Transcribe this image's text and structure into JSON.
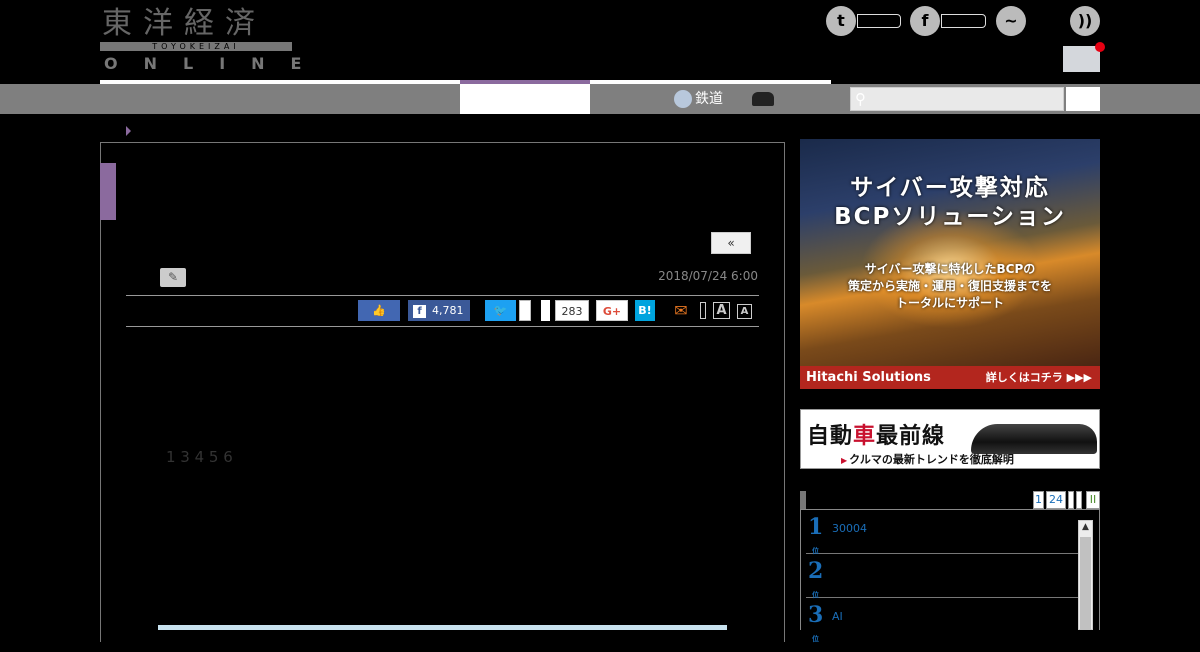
{
  "header": {
    "logo": {
      "kanji": "東洋経済",
      "sub": "TOYOKEIZAI",
      "online": "ONLINE"
    },
    "social": [
      {
        "name": "twitter-icon",
        "glyph": "t"
      },
      {
        "name": "facebook-icon",
        "glyph": "f"
      },
      {
        "name": "messenger-icon",
        "glyph": "~"
      },
      {
        "name": "rss-icon",
        "glyph": "))"
      }
    ]
  },
  "nav": {
    "rail_label": "鉄道",
    "search_placeholder": ""
  },
  "article": {
    "pager_label": "«",
    "date": "2018/07/24 6:00",
    "share": {
      "fb_count": "4,781",
      "hatena_count": "283",
      "gplus": "G+",
      "hatena": "B!",
      "font_large": "A",
      "font_small": "A"
    },
    "paragraphs": [
      "",
      "1 3 4 5 6",
      ""
    ]
  },
  "sidebar": {
    "ad1": {
      "headline1": "サイバー攻撃対応",
      "headline2": "BCPソリューション",
      "sub1": "サイバー攻撃に特化したBCPの",
      "sub2": "策定から実施・運用・復旧支援までを",
      "sub3": "トータルにサポート",
      "brand": "Hitachi Solutions",
      "cta": "詳しくはコチラ ▶▶▶"
    },
    "ad2": {
      "title_a": "自動",
      "title_b": "車",
      "title_c": "最前線",
      "sub": "クルマの最新トレンドを徹底解明"
    },
    "ranking": {
      "tabs": [
        "1",
        "24"
      ],
      "items": [
        {
          "rank": "1",
          "text": "30004"
        },
        {
          "rank": "2",
          "text": ""
        },
        {
          "rank": "3",
          "text": "AI"
        }
      ]
    }
  },
  "colors": {
    "accent": "#8b6a9e",
    "nav_bg": "#7f7f7f",
    "link": "#1a6eb8"
  }
}
